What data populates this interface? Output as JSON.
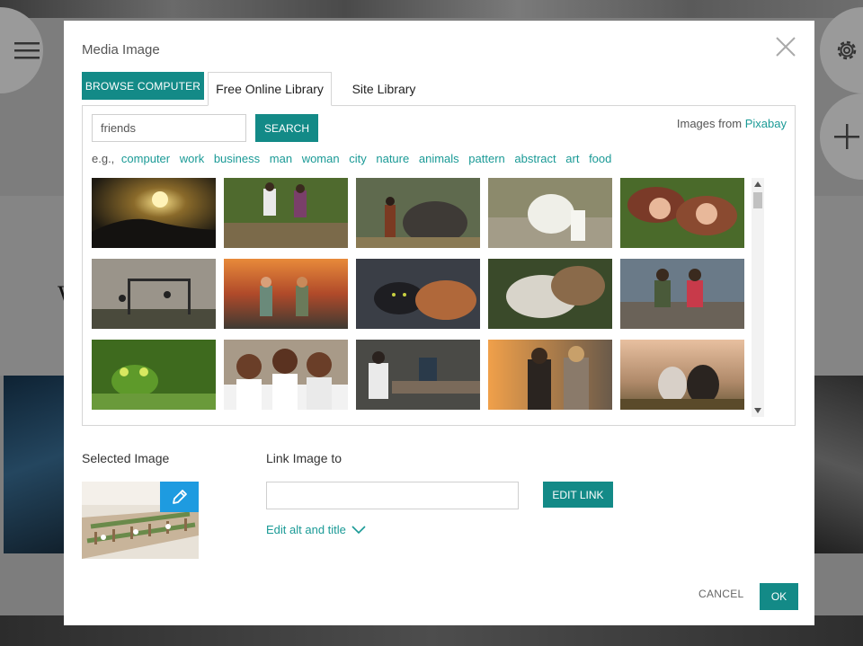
{
  "modal": {
    "title": "Media Image",
    "close_icon": "close-icon"
  },
  "tabs": [
    {
      "label": "BROWSE COMPUTER"
    },
    {
      "label": "Free Online Library",
      "active": true
    },
    {
      "label": "Site Library"
    }
  ],
  "search": {
    "value": "friends",
    "button_label": "SEARCH",
    "source_prefix": "Images from",
    "source_name": "Pixabay"
  },
  "suggestions": {
    "prefix": "e.g.,",
    "terms": [
      "computer",
      "work",
      "business",
      "man",
      "woman",
      "city",
      "nature",
      "animals",
      "pattern",
      "abstract",
      "art",
      "food"
    ]
  },
  "selected": {
    "label": "Selected Image",
    "edit_icon": "pencil-icon"
  },
  "link": {
    "label": "Link Image to",
    "value": "",
    "button_label": "EDIT LINK",
    "alt_label": "Edit alt and title"
  },
  "footer": {
    "cancel_label": "CANCEL",
    "ok_label": "OK"
  },
  "colors": {
    "accent": "#138a87",
    "link": "#1a9a96",
    "edit_blue": "#1e9be0"
  }
}
